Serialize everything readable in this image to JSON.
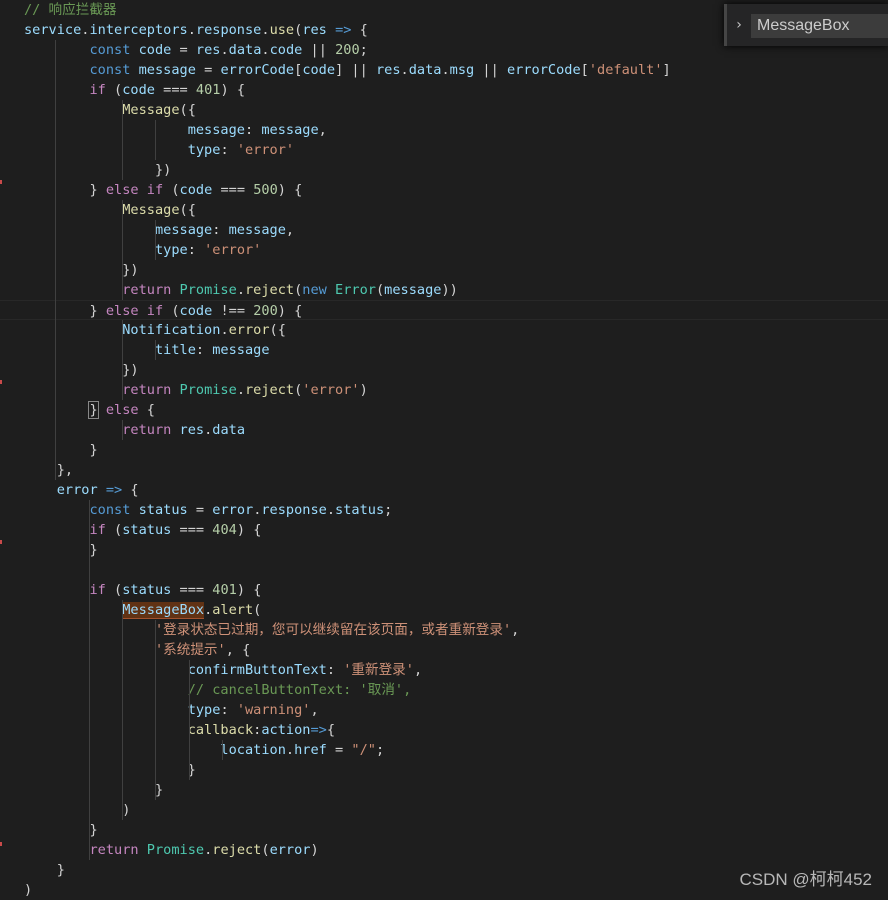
{
  "colors": {
    "background": "#1e1e1e",
    "default": "#d4d4d4",
    "keyword": "#569cd6",
    "control": "#c586c0",
    "variable": "#9cdcfe",
    "function": "#dcdcaa",
    "string": "#ce9178",
    "number": "#b5cea8",
    "comment": "#6a9955",
    "class": "#4ec9b0",
    "word_highlight": "#613214"
  },
  "find_widget": {
    "toggle_icon": "chevron-right-icon",
    "toggle_glyph": "›",
    "query": "MessageBox"
  },
  "watermark": "CSDN @柯柯452",
  "code_lines": [
    [
      [
        "comment",
        "// 响应拦截器"
      ]
    ],
    [
      [
        "variable",
        "service"
      ],
      [
        "default",
        "."
      ],
      [
        "variable",
        "interceptors"
      ],
      [
        "default",
        "."
      ],
      [
        "variable",
        "response"
      ],
      [
        "default",
        "."
      ],
      [
        "function",
        "use"
      ],
      [
        "default",
        "("
      ],
      [
        "variable",
        "res"
      ],
      [
        "default",
        " "
      ],
      [
        "keyword",
        "=>"
      ],
      [
        "default",
        " {"
      ]
    ],
    [
      [
        "default",
        "        "
      ],
      [
        "keyword",
        "const"
      ],
      [
        "default",
        " "
      ],
      [
        "variable",
        "code"
      ],
      [
        "default",
        " = "
      ],
      [
        "variable",
        "res"
      ],
      [
        "default",
        "."
      ],
      [
        "variable",
        "data"
      ],
      [
        "default",
        "."
      ],
      [
        "variable",
        "code"
      ],
      [
        "default",
        " || "
      ],
      [
        "number",
        "200"
      ],
      [
        "default",
        ";"
      ]
    ],
    [
      [
        "default",
        "        "
      ],
      [
        "keyword",
        "const"
      ],
      [
        "default",
        " "
      ],
      [
        "variable",
        "message"
      ],
      [
        "default",
        " = "
      ],
      [
        "variable",
        "errorCode"
      ],
      [
        "default",
        "["
      ],
      [
        "variable",
        "code"
      ],
      [
        "default",
        "] || "
      ],
      [
        "variable",
        "res"
      ],
      [
        "default",
        "."
      ],
      [
        "variable",
        "data"
      ],
      [
        "default",
        "."
      ],
      [
        "variable",
        "msg"
      ],
      [
        "default",
        " || "
      ],
      [
        "variable",
        "errorCode"
      ],
      [
        "default",
        "["
      ],
      [
        "string",
        "'default'"
      ],
      [
        "default",
        "]"
      ]
    ],
    [
      [
        "default",
        "        "
      ],
      [
        "control",
        "if"
      ],
      [
        "default",
        " ("
      ],
      [
        "variable",
        "code"
      ],
      [
        "default",
        " === "
      ],
      [
        "number",
        "401"
      ],
      [
        "default",
        ") {"
      ]
    ],
    [
      [
        "default",
        "            "
      ],
      [
        "function",
        "Message"
      ],
      [
        "default",
        "({"
      ]
    ],
    [
      [
        "default",
        "                    "
      ],
      [
        "variable",
        "message"
      ],
      [
        "default",
        ": "
      ],
      [
        "variable",
        "message"
      ],
      [
        "default",
        ","
      ]
    ],
    [
      [
        "default",
        "                    "
      ],
      [
        "variable",
        "type"
      ],
      [
        "default",
        ": "
      ],
      [
        "string",
        "'error'"
      ]
    ],
    [
      [
        "default",
        "                })"
      ]
    ],
    [
      [
        "default",
        "        } "
      ],
      [
        "control",
        "else"
      ],
      [
        "default",
        " "
      ],
      [
        "control",
        "if"
      ],
      [
        "default",
        " ("
      ],
      [
        "variable",
        "code"
      ],
      [
        "default",
        " === "
      ],
      [
        "number",
        "500"
      ],
      [
        "default",
        ") {"
      ]
    ],
    [
      [
        "default",
        "            "
      ],
      [
        "function",
        "Message"
      ],
      [
        "default",
        "({"
      ]
    ],
    [
      [
        "default",
        "                "
      ],
      [
        "variable",
        "message"
      ],
      [
        "default",
        ": "
      ],
      [
        "variable",
        "message"
      ],
      [
        "default",
        ","
      ]
    ],
    [
      [
        "default",
        "                "
      ],
      [
        "variable",
        "type"
      ],
      [
        "default",
        ": "
      ],
      [
        "string",
        "'error'"
      ]
    ],
    [
      [
        "default",
        "            })"
      ]
    ],
    [
      [
        "default",
        "            "
      ],
      [
        "control",
        "return"
      ],
      [
        "default",
        " "
      ],
      [
        "class",
        "Promise"
      ],
      [
        "default",
        "."
      ],
      [
        "function",
        "reject"
      ],
      [
        "default",
        "("
      ],
      [
        "keyword",
        "new"
      ],
      [
        "default",
        " "
      ],
      [
        "class",
        "Error"
      ],
      [
        "default",
        "("
      ],
      [
        "variable",
        "message"
      ],
      [
        "default",
        "))"
      ]
    ],
    [
      [
        "default",
        "        } "
      ],
      [
        "control",
        "else"
      ],
      [
        "default",
        " "
      ],
      [
        "control",
        "if"
      ],
      [
        "default",
        " ("
      ],
      [
        "variable",
        "code"
      ],
      [
        "default",
        " !== "
      ],
      [
        "number",
        "200"
      ],
      [
        "default",
        ") "
      ],
      [
        "default",
        "{"
      ]
    ],
    [
      [
        "default",
        "            "
      ],
      [
        "variable",
        "Notification"
      ],
      [
        "default",
        "."
      ],
      [
        "function",
        "error"
      ],
      [
        "default",
        "({"
      ]
    ],
    [
      [
        "default",
        "                "
      ],
      [
        "variable",
        "title"
      ],
      [
        "default",
        ": "
      ],
      [
        "variable",
        "message"
      ]
    ],
    [
      [
        "default",
        "            })"
      ]
    ],
    [
      [
        "default",
        "            "
      ],
      [
        "control",
        "return"
      ],
      [
        "default",
        " "
      ],
      [
        "class",
        "Promise"
      ],
      [
        "default",
        "."
      ],
      [
        "function",
        "reject"
      ],
      [
        "default",
        "("
      ],
      [
        "string",
        "'error'"
      ],
      [
        "default",
        ")"
      ]
    ],
    [
      [
        "default",
        "        "
      ],
      [
        "default",
        "}"
      ],
      [
        "default",
        " "
      ],
      [
        "control",
        "else"
      ],
      [
        "default",
        " {"
      ]
    ],
    [
      [
        "default",
        "            "
      ],
      [
        "control",
        "return"
      ],
      [
        "default",
        " "
      ],
      [
        "variable",
        "res"
      ],
      [
        "default",
        "."
      ],
      [
        "variable",
        "data"
      ]
    ],
    [
      [
        "default",
        "        }"
      ]
    ],
    [
      [
        "default",
        "    },"
      ]
    ],
    [
      [
        "default",
        "    "
      ],
      [
        "variable",
        "error"
      ],
      [
        "default",
        " "
      ],
      [
        "keyword",
        "=>"
      ],
      [
        "default",
        " {"
      ]
    ],
    [
      [
        "default",
        "        "
      ],
      [
        "keyword",
        "const"
      ],
      [
        "default",
        " "
      ],
      [
        "variable",
        "status"
      ],
      [
        "default",
        " = "
      ],
      [
        "variable",
        "error"
      ],
      [
        "default",
        "."
      ],
      [
        "variable",
        "response"
      ],
      [
        "default",
        "."
      ],
      [
        "variable",
        "status"
      ],
      [
        "default",
        ";"
      ]
    ],
    [
      [
        "default",
        "        "
      ],
      [
        "control",
        "if"
      ],
      [
        "default",
        " ("
      ],
      [
        "variable",
        "status"
      ],
      [
        "default",
        " === "
      ],
      [
        "number",
        "404"
      ],
      [
        "default",
        ") {"
      ]
    ],
    [
      [
        "default",
        "        }"
      ]
    ],
    [
      [
        "default",
        ""
      ]
    ],
    [
      [
        "default",
        "        "
      ],
      [
        "control",
        "if"
      ],
      [
        "default",
        " ("
      ],
      [
        "variable",
        "status"
      ],
      [
        "default",
        " === "
      ],
      [
        "number",
        "401"
      ],
      [
        "default",
        ") {"
      ]
    ],
    [
      [
        "default",
        "            "
      ],
      [
        "variable",
        "MessageBox"
      ],
      [
        "default",
        "."
      ],
      [
        "function",
        "alert"
      ],
      [
        "default",
        "("
      ]
    ],
    [
      [
        "default",
        "                "
      ],
      [
        "string",
        "'登录状态已过期，您可以继续留在该页面，或者重新登录'"
      ],
      [
        "default",
        ","
      ]
    ],
    [
      [
        "default",
        "                "
      ],
      [
        "string",
        "'系统提示'"
      ],
      [
        "default",
        ", {"
      ]
    ],
    [
      [
        "default",
        "                    "
      ],
      [
        "variable",
        "confirmButtonText"
      ],
      [
        "default",
        ": "
      ],
      [
        "string",
        "'重新登录'"
      ],
      [
        "default",
        ","
      ]
    ],
    [
      [
        "default",
        "                    "
      ],
      [
        "comment",
        "// cancelButtonText: '取消',"
      ]
    ],
    [
      [
        "default",
        "                    "
      ],
      [
        "variable",
        "type"
      ],
      [
        "default",
        ": "
      ],
      [
        "string",
        "'warning'"
      ],
      [
        "default",
        ","
      ]
    ],
    [
      [
        "default",
        "                    "
      ],
      [
        "function",
        "callback"
      ],
      [
        "default",
        ":"
      ],
      [
        "variable",
        "action"
      ],
      [
        "keyword",
        "=>"
      ],
      [
        "default",
        "{"
      ]
    ],
    [
      [
        "default",
        "                        "
      ],
      [
        "variable",
        "location"
      ],
      [
        "default",
        "."
      ],
      [
        "variable",
        "href"
      ],
      [
        "default",
        " = "
      ],
      [
        "string",
        "\"/\""
      ],
      [
        "default",
        ";"
      ]
    ],
    [
      [
        "default",
        "                    }"
      ]
    ],
    [
      [
        "default",
        "                }"
      ]
    ],
    [
      [
        "default",
        "            )"
      ]
    ],
    [
      [
        "default",
        "        }"
      ]
    ],
    [
      [
        "default",
        "        "
      ],
      [
        "control",
        "return"
      ],
      [
        "default",
        " "
      ],
      [
        "class",
        "Promise"
      ],
      [
        "default",
        "."
      ],
      [
        "function",
        "reject"
      ],
      [
        "default",
        "("
      ],
      [
        "variable",
        "error"
      ],
      [
        "default",
        ")"
      ]
    ],
    [
      [
        "default",
        "    }"
      ]
    ],
    [
      [
        "default",
        ")"
      ]
    ]
  ]
}
